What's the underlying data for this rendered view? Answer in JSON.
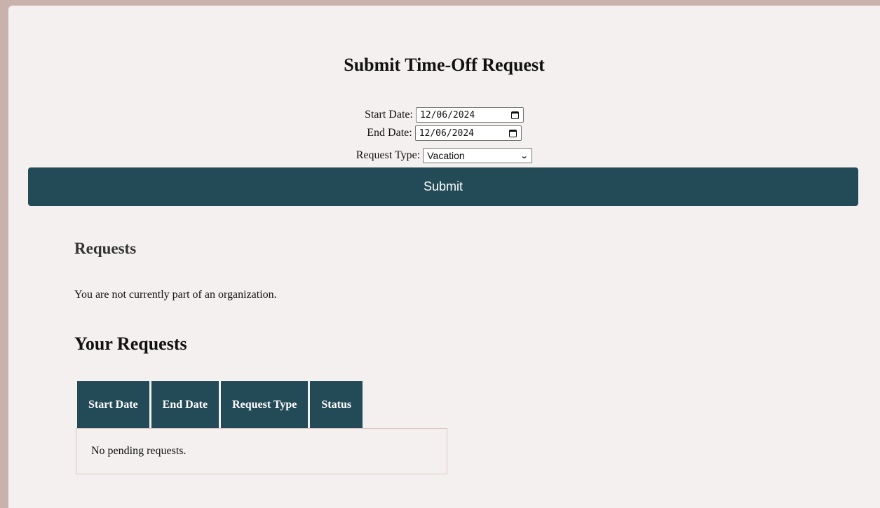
{
  "form": {
    "title": "Submit Time-Off Request",
    "start_label": "Start Date:",
    "start_value": "12/06/2024",
    "end_label": "End Date:",
    "end_value": "12/06/2024",
    "type_label": "Request Type:",
    "type_value": "Vacation",
    "submit_label": "Submit"
  },
  "requests": {
    "heading": "Requests",
    "message": "You are not currently part of an organization."
  },
  "your_requests": {
    "heading": "Your Requests",
    "columns": [
      "Start Date",
      "End Date",
      "Request Type",
      "Status"
    ],
    "empty_message": "No pending requests."
  },
  "colors": {
    "accent": "#234a57",
    "background": "#f4f0ef"
  }
}
